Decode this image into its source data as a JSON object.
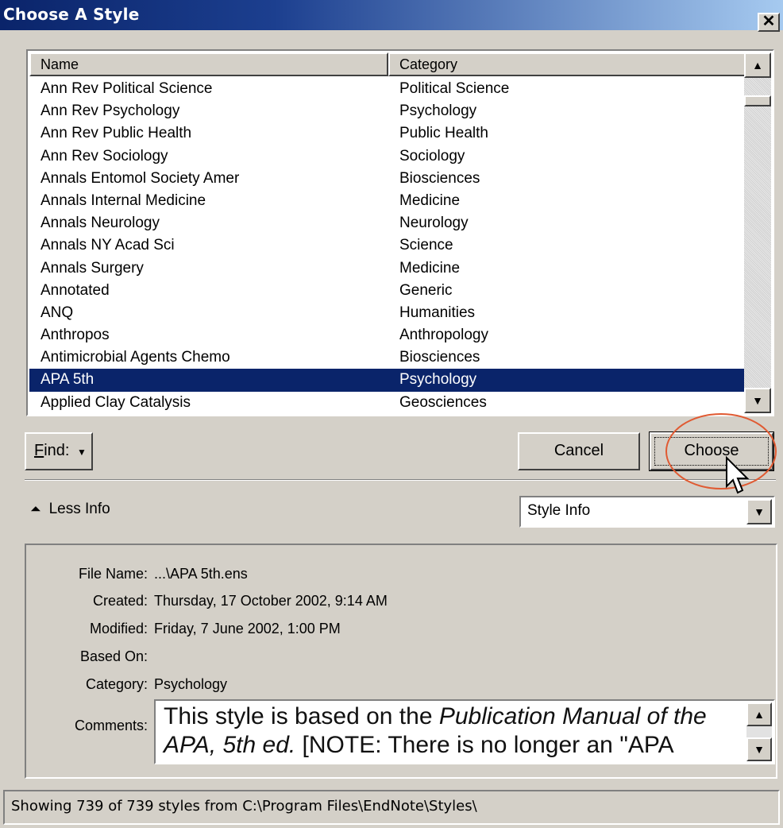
{
  "window": {
    "title": "Choose A Style",
    "close_glyph": "✕"
  },
  "list": {
    "columns": [
      "Name",
      "Category"
    ],
    "rows": [
      {
        "name": "Ann Rev Political Science",
        "category": "Political Science"
      },
      {
        "name": "Ann Rev Psychology",
        "category": "Psychology"
      },
      {
        "name": "Ann Rev Public Health",
        "category": "Public Health"
      },
      {
        "name": "Ann Rev Sociology",
        "category": "Sociology"
      },
      {
        "name": "Annals Entomol Society Amer",
        "category": "Biosciences"
      },
      {
        "name": "Annals Internal Medicine",
        "category": "Medicine"
      },
      {
        "name": "Annals Neurology",
        "category": "Neurology"
      },
      {
        "name": "Annals NY Acad Sci",
        "category": "Science"
      },
      {
        "name": "Annals Surgery",
        "category": "Medicine"
      },
      {
        "name": "Annotated",
        "category": "Generic"
      },
      {
        "name": "ANQ",
        "category": "Humanities"
      },
      {
        "name": "Anthropos",
        "category": "Anthropology"
      },
      {
        "name": "Antimicrobial Agents Chemo",
        "category": "Biosciences"
      },
      {
        "name": "APA 5th",
        "category": "Psychology",
        "selected": true
      },
      {
        "name": "Applied Clay Catalysis",
        "category": "Geosciences"
      }
    ]
  },
  "buttons": {
    "find": "Find:",
    "find_accel": "F",
    "find_rest": "ind:",
    "cancel": "Cancel",
    "choose": "Choose"
  },
  "info_toggle": {
    "label": "Less Info",
    "icon": "double-up-arrow"
  },
  "info_select": {
    "value": "Style Info"
  },
  "style_info": {
    "labels": {
      "file_name": "File Name:",
      "created": "Created:",
      "modified": "Modified:",
      "based_on": "Based On:",
      "category": "Category:",
      "comments": "Comments:"
    },
    "file_name": "...\\APA 5th.ens",
    "created": "Thursday, 17 October 2002, 9:14 AM",
    "modified": "Friday, 7 June 2002, 1:00 PM",
    "based_on": "",
    "category": "Psychology",
    "comments_pre": "This style is based on the ",
    "comments_italic": "Publication Manual of the APA, 5th ed.",
    "comments_post": " [NOTE: There is no longer an \"APA"
  },
  "status_bar": "Showing 739 of 739 styles from C:\\Program Files\\EndNote\\Styles\\",
  "colors": {
    "selection": "#0a246a",
    "annotation_circle": "#e05a32",
    "face": "#d4d0c8"
  }
}
